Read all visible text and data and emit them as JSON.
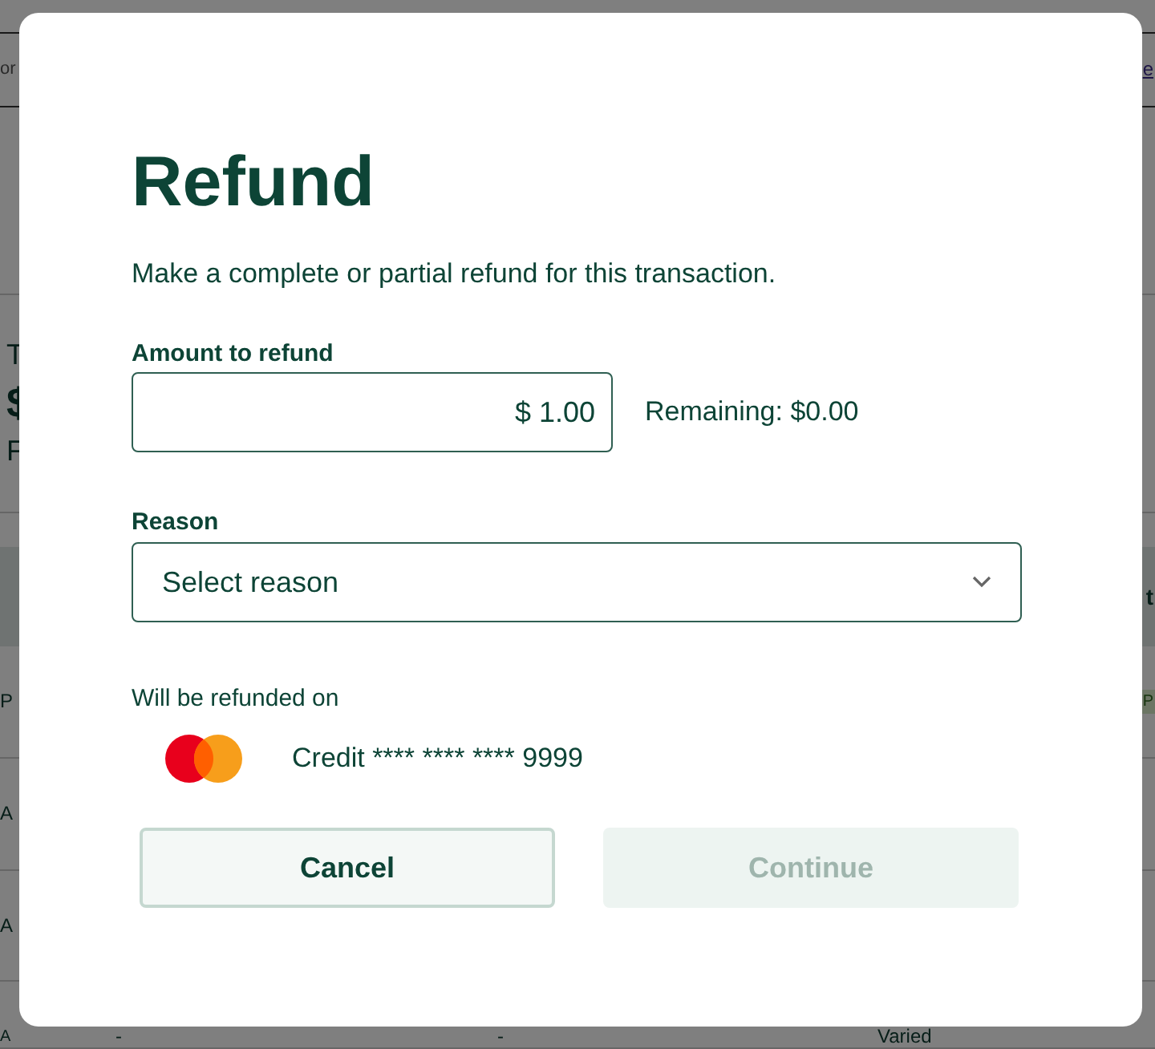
{
  "background": {
    "search_fragment": "or",
    "link_fragment": "e",
    "summary": [
      "T",
      "$",
      "F"
    ],
    "header_fragment": "t",
    "rows": [
      {
        "col1": "P",
        "badge": "P"
      },
      {
        "col1": "A"
      },
      {
        "col1": "A"
      },
      {
        "col1": "A",
        "col2": "-",
        "col3": "-",
        "col4": "Varied"
      }
    ]
  },
  "dialog": {
    "title": "Refund",
    "description": "Make a complete or partial refund for this transaction.",
    "amount": {
      "label": "Amount to refund",
      "value": "$ 1.00",
      "remaining": "Remaining: $0.00"
    },
    "reason": {
      "label": "Reason",
      "placeholder": "Select reason"
    },
    "refund_method": {
      "label": "Will be refunded on",
      "card": "Credit **** **** **** 9999"
    },
    "buttons": [
      {
        "label": "Cancel",
        "disabled": false
      },
      {
        "label": "Continue",
        "disabled": true
      }
    ]
  }
}
